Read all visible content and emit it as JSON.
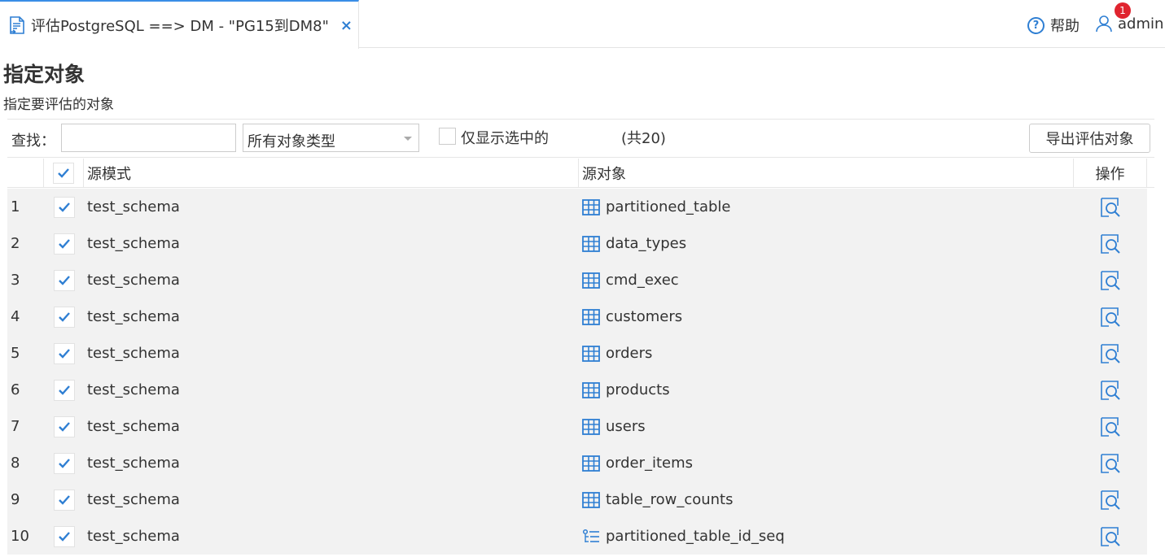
{
  "tab": {
    "title": "评估PostgreSQL ==> DM - \"PG15到DM8\"",
    "close": "×"
  },
  "header": {
    "help_label": "帮助",
    "user": "admin",
    "notification_count": "1"
  },
  "page": {
    "title": "指定对象",
    "subtitle": "指定要评估的对象"
  },
  "filter": {
    "find_label": "查找：",
    "search_value": "",
    "type_select": "所有对象类型",
    "only_selected_label": "仅显示选中的",
    "total": "(共20)",
    "export_label": "导出评估对象"
  },
  "table": {
    "columns": {
      "schema": "源模式",
      "object": "源对象",
      "op": "操作"
    },
    "rows": [
      {
        "idx": "1",
        "schema": "test_schema",
        "object": "partitioned_table",
        "kind": "table"
      },
      {
        "idx": "2",
        "schema": "test_schema",
        "object": "data_types",
        "kind": "table"
      },
      {
        "idx": "3",
        "schema": "test_schema",
        "object": "cmd_exec",
        "kind": "table"
      },
      {
        "idx": "4",
        "schema": "test_schema",
        "object": "customers",
        "kind": "table"
      },
      {
        "idx": "5",
        "schema": "test_schema",
        "object": "orders",
        "kind": "table"
      },
      {
        "idx": "6",
        "schema": "test_schema",
        "object": "products",
        "kind": "table"
      },
      {
        "idx": "7",
        "schema": "test_schema",
        "object": "users",
        "kind": "table"
      },
      {
        "idx": "8",
        "schema": "test_schema",
        "object": "order_items",
        "kind": "table"
      },
      {
        "idx": "9",
        "schema": "test_schema",
        "object": "table_row_counts",
        "kind": "table"
      },
      {
        "idx": "10",
        "schema": "test_schema",
        "object": "partitioned_table_id_seq",
        "kind": "sequence"
      }
    ]
  },
  "colors": {
    "accent": "#2f7fd3",
    "badge": "#e0242f",
    "row_bg": "#f2f2f2"
  }
}
